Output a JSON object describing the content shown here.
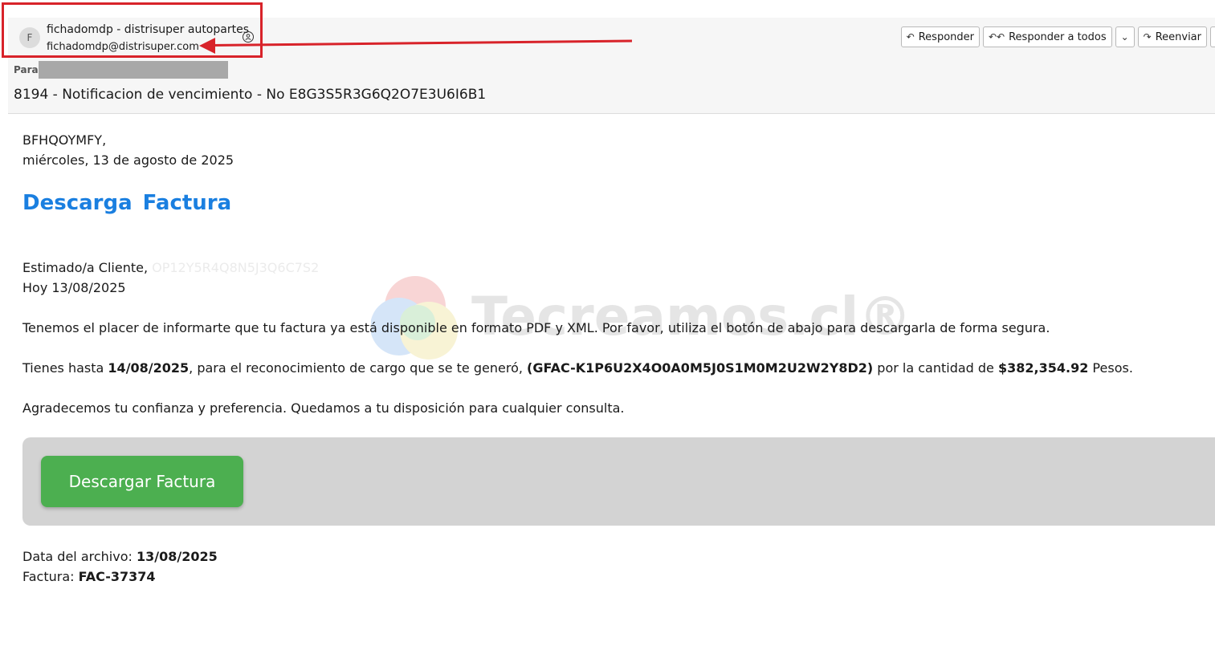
{
  "header": {
    "avatar_initial": "F",
    "sender_name": "fichadomdp - distrisuper autopartes",
    "sender_email": "fichadomdp@distrisuper.com",
    "to_label": "Para",
    "subject": "8194 - Notificacion de vencimiento - No E8G3S5R3G6Q2O7E3U6I6B1",
    "actions": {
      "reply": "Responder",
      "reply_all": "Responder a todos",
      "forward": "Reenviar"
    }
  },
  "body": {
    "greeting_code": "BFHQOYMFY,",
    "date_line": "miércoles, 13 de agosto de 2025",
    "heading": "Descarga  Factura",
    "dear": "Estimado/a  Cliente,",
    "hidden_code": "OP12Y5R4Q8N5J3Q6C7S2",
    "today": "Hoy  13/08/2025",
    "paragraph1": "Tenemos  el placer  de  informarte que  tu  factura   ya está  disponible en  formato   PDF  y XML.  Por   favor, utiliza  el  botón  de abajo  para descargarla  de  forma segura.",
    "p2_start": "Tienes   hasta ",
    "p2_date": "14/08/2025",
    "p2_mid": ", para   el reconocimiento  de cargo   que se  te generó,  ",
    "p2_ref": "(GFAC-K1P6U2X4O0A0M5J0S1M0M2U2W2Y8D2)",
    "p2_mid2": "  por la   cantidad   de  ",
    "p2_amount": "$382,354.92",
    "p2_end": "  Pesos.",
    "paragraph3": "Agradecemos tu confianza y  preferencia.  Quedamos  a tu  disposición  para  cualquier consulta.",
    "download_button": "Descargar Factura",
    "file_date_label": "Data   del  archivo: ",
    "file_date_value": "13/08/2025",
    "invoice_label": "Factura:  ",
    "invoice_value": "FAC-37374"
  },
  "watermark": {
    "text": "Tecreamos.cl®"
  },
  "colors": {
    "heading": "#1a7fe0",
    "button": "#4caf50",
    "highlight": "#d8232a",
    "panel": "#d3d3d3"
  }
}
